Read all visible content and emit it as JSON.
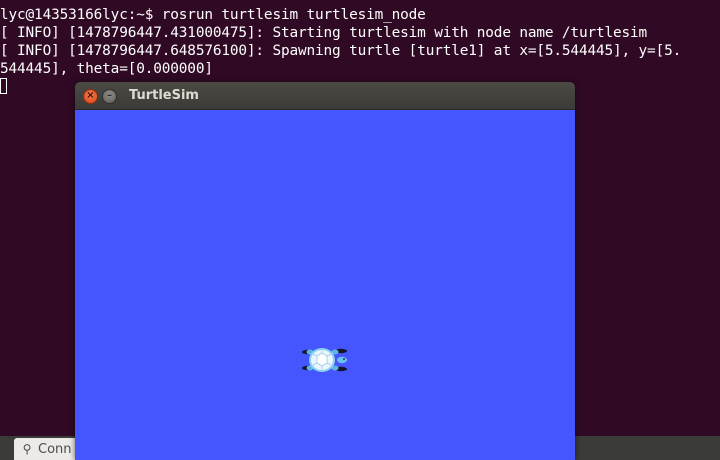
{
  "terminal": {
    "lines": [
      "lyc@14353166lyc:~$ rosrun turtlesim turtlesim_node",
      "[ INFO] [1478796447.431000475]: Starting turtlesim with node name /turtlesim",
      "[ INFO] [1478796447.648576100]: Spawning turtle [turtle1] at x=[5.544445], y=[5.",
      "544445], theta=[0.000000]"
    ],
    "background": "#300a24",
    "text_color": "#ffffff"
  },
  "window": {
    "title": "TurtleSim",
    "close_glyph": "×",
    "minimize_glyph": "–",
    "canvas_color": "#4556ff"
  },
  "turtle": {
    "icon": "turtle-icon"
  },
  "taskbar": {
    "item_label": "Conn",
    "item_icon": "connection-icon",
    "item_glyph": "⚲"
  }
}
